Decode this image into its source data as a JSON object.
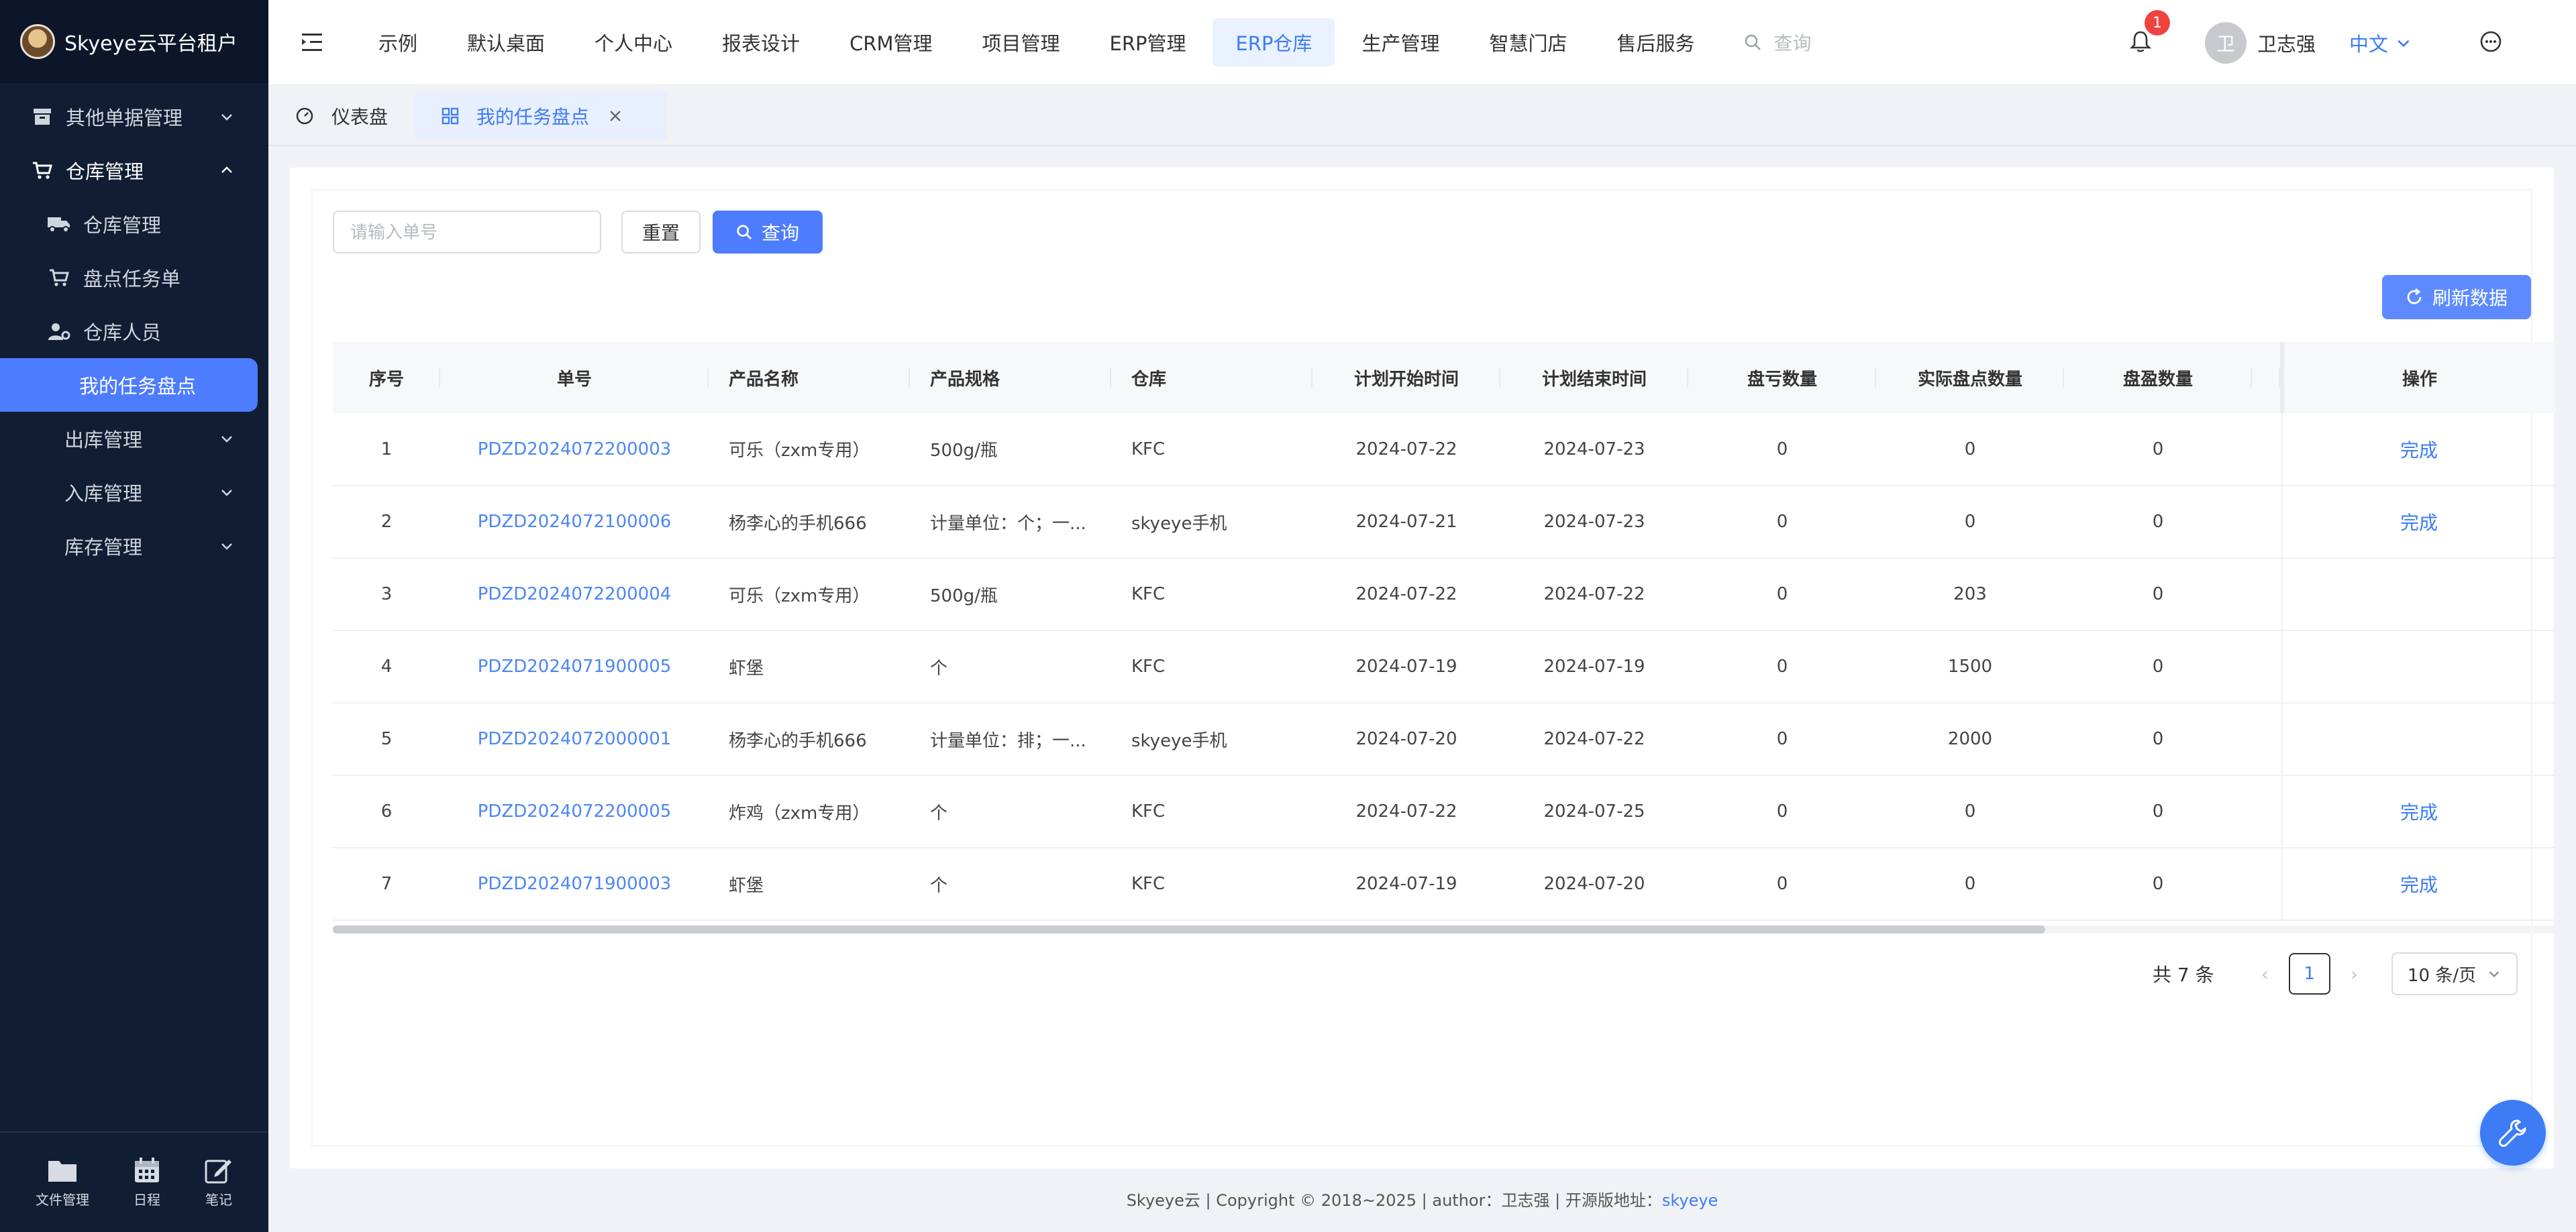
{
  "brand": {
    "name": "Skyeye云平台租户"
  },
  "sidebar": {
    "items": [
      {
        "label": "其他单据管理"
      },
      {
        "label": "仓库管理"
      },
      {
        "label": "出库管理"
      },
      {
        "label": "入库管理"
      },
      {
        "label": "库存管理"
      }
    ],
    "subitems": [
      {
        "label": "仓库管理"
      },
      {
        "label": "盘点任务单"
      },
      {
        "label": "仓库人员"
      },
      {
        "label": "我的任务盘点"
      }
    ],
    "tools": [
      {
        "label": "文件管理"
      },
      {
        "label": "日程"
      },
      {
        "label": "笔记"
      }
    ]
  },
  "topnav": {
    "items": [
      {
        "label": "示例"
      },
      {
        "label": "默认桌面"
      },
      {
        "label": "个人中心"
      },
      {
        "label": "报表设计"
      },
      {
        "label": "CRM管理"
      },
      {
        "label": "项目管理"
      },
      {
        "label": "ERP管理"
      },
      {
        "label": "ERP仓库"
      },
      {
        "label": "生产管理"
      },
      {
        "label": "智慧门店"
      },
      {
        "label": "售后服务"
      }
    ],
    "search_placeholder": "查询"
  },
  "user": {
    "notification_count": "1",
    "avatar_text": "卫",
    "name": "卫志强",
    "language": "中文"
  },
  "tabs": [
    {
      "label": "仪表盘"
    },
    {
      "label": "我的任务盘点"
    }
  ],
  "filter": {
    "placeholder": "请输入单号",
    "reset_label": "重置",
    "query_label": "查询",
    "refresh_label": "刷新数据"
  },
  "table": {
    "headers": {
      "index": "序号",
      "order_no": "单号",
      "product_name": "产品名称",
      "spec": "产品规格",
      "warehouse": "仓库",
      "plan_start": "计划开始时间",
      "plan_end": "计划结束时间",
      "loss_qty": "盘亏数量",
      "actual_qty": "实际盘点数量",
      "gain_qty": "盘盈数量",
      "action": "操作"
    },
    "rows": [
      {
        "index": "1",
        "order_no": "PDZD2024072200003",
        "product_name": "可乐（zxm专用）",
        "spec": "500g/瓶",
        "warehouse": "KFC",
        "plan_start": "2024-07-22",
        "plan_end": "2024-07-23",
        "loss_qty": "0",
        "actual_qty": "0",
        "gain_qty": "0",
        "action": "完成"
      },
      {
        "index": "2",
        "order_no": "PDZD2024072100006",
        "product_name": "杨李心的手机666",
        "spec": "计量单位：个；一...",
        "warehouse": "skyeye手机",
        "plan_start": "2024-07-21",
        "plan_end": "2024-07-23",
        "loss_qty": "0",
        "actual_qty": "0",
        "gain_qty": "0",
        "action": "完成"
      },
      {
        "index": "3",
        "order_no": "PDZD2024072200004",
        "product_name": "可乐（zxm专用）",
        "spec": "500g/瓶",
        "warehouse": "KFC",
        "plan_start": "2024-07-22",
        "plan_end": "2024-07-22",
        "loss_qty": "0",
        "actual_qty": "203",
        "gain_qty": "0",
        "action": ""
      },
      {
        "index": "4",
        "order_no": "PDZD2024071900005",
        "product_name": "虾堡",
        "spec": "个",
        "warehouse": "KFC",
        "plan_start": "2024-07-19",
        "plan_end": "2024-07-19",
        "loss_qty": "0",
        "actual_qty": "1500",
        "gain_qty": "0",
        "action": ""
      },
      {
        "index": "5",
        "order_no": "PDZD2024072000001",
        "product_name": "杨李心的手机666",
        "spec": "计量单位：排；一...",
        "warehouse": "skyeye手机",
        "plan_start": "2024-07-20",
        "plan_end": "2024-07-22",
        "loss_qty": "0",
        "actual_qty": "2000",
        "gain_qty": "0",
        "action": ""
      },
      {
        "index": "6",
        "order_no": "PDZD2024072200005",
        "product_name": "炸鸡（zxm专用）",
        "spec": "个",
        "warehouse": "KFC",
        "plan_start": "2024-07-22",
        "plan_end": "2024-07-25",
        "loss_qty": "0",
        "actual_qty": "0",
        "gain_qty": "0",
        "action": "完成"
      },
      {
        "index": "7",
        "order_no": "PDZD2024071900003",
        "product_name": "虾堡",
        "spec": "个",
        "warehouse": "KFC",
        "plan_start": "2024-07-19",
        "plan_end": "2024-07-20",
        "loss_qty": "0",
        "actual_qty": "0",
        "gain_qty": "0",
        "action": "完成"
      }
    ]
  },
  "pagination": {
    "total": "共 7 条",
    "current_page": "1",
    "page_size": "10 条/页"
  },
  "footer": {
    "text": "Skyeye云 | Copyright © 2018~2025 | author：卫志强 | 开源版地址：",
    "link": "skyeye"
  },
  "colors": {
    "accent": "#4d7cfe",
    "sidebar_bg": "#101d33",
    "badge": "#f0433f"
  }
}
